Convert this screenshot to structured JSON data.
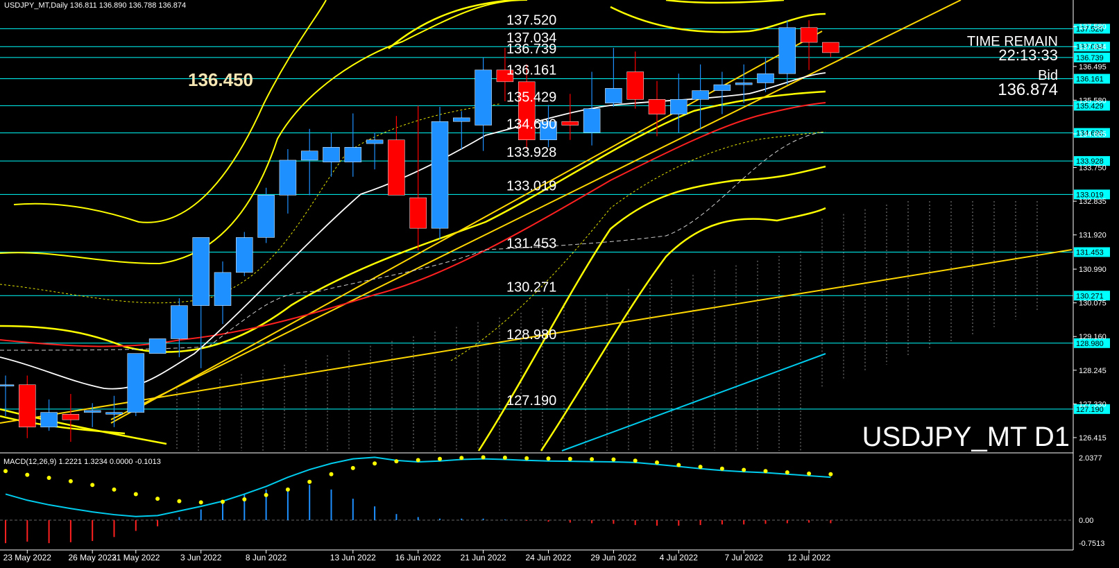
{
  "header": "USDJPY_MT,Daily  136.811 136.890 136.788 136.874",
  "symbol_label": "USDJPY_MT D1",
  "time_remain_label": "TIME REMAIN",
  "time_remain_value": "22:13:33",
  "bid_label": "Bid",
  "bid_value": "136.874",
  "marker_label": "136.450",
  "macd_label": "MACD(12,26,9) 1.2221 1.3234 0.0000 -0.1013",
  "colors": {
    "bull": "#1e90ff",
    "bear": "#ff0000",
    "level": "#00ffff",
    "trend": "#ffd700",
    "bands": "#ffff00",
    "ma_red": "#ff2020",
    "ma_white": "#ffffff",
    "macd_line": "#00ccee",
    "macd_signal": "#ffff00"
  },
  "chart_data": {
    "type": "candlestick",
    "dates": [
      "2022-05-20",
      "2022-05-23",
      "2022-05-24",
      "2022-05-25",
      "2022-05-26",
      "2022-05-27",
      "2022-05-30",
      "2022-05-31",
      "2022-06-01",
      "2022-06-02",
      "2022-06-03",
      "2022-06-06",
      "2022-06-07",
      "2022-06-08",
      "2022-06-09",
      "2022-06-10",
      "2022-06-13",
      "2022-06-14",
      "2022-06-15",
      "2022-06-16",
      "2022-06-17",
      "2022-06-20",
      "2022-06-21",
      "2022-06-22",
      "2022-06-23",
      "2022-06-24",
      "2022-06-27",
      "2022-06-28",
      "2022-06-29",
      "2022-06-30",
      "2022-07-01",
      "2022-07-04",
      "2022-07-05",
      "2022-07-06",
      "2022-07-07",
      "2022-07-08",
      "2022-07-11",
      "2022-07-12",
      "2022-07-13"
    ],
    "open": [
      127.85,
      127.85,
      126.7,
      127.05,
      127.1,
      127.05,
      127.1,
      128.7,
      129.1,
      130.0,
      130.0,
      130.9,
      131.85,
      133.0,
      133.95,
      133.9,
      133.9,
      134.4,
      134.5,
      132.93,
      132.1,
      135.0,
      134.9,
      136.4,
      136.08,
      134.5,
      135.0,
      134.7,
      135.5,
      136.35,
      135.6,
      135.2,
      135.6,
      135.84,
      136.0,
      136.05,
      136.3,
      137.55,
      137.15
    ],
    "high": [
      128.1,
      128.1,
      127.45,
      127.6,
      127.35,
      127.55,
      128.5,
      128.95,
      130.2,
      130.6,
      131.2,
      132.0,
      133.2,
      134.25,
      134.8,
      134.7,
      135.22,
      134.7,
      135.15,
      135.43,
      135.4,
      135.28,
      136.74,
      137.0,
      136.55,
      135.45,
      135.75,
      136.35,
      137.0,
      136.9,
      136.1,
      136.3,
      136.55,
      136.35,
      136.55,
      136.75,
      137.75,
      137.75,
      136.9
    ],
    "low": [
      127.0,
      126.4,
      126.6,
      126.3,
      126.7,
      126.7,
      127.0,
      128.7,
      128.6,
      128.3,
      129.5,
      130.8,
      131.7,
      132.5,
      133.0,
      133.5,
      133.5,
      133.7,
      133.5,
      131.5,
      131.8,
      134.25,
      134.2,
      135.55,
      134.25,
      134.3,
      134.5,
      134.35,
      135.4,
      135.35,
      134.6,
      134.7,
      134.8,
      135.2,
      135.5,
      135.8,
      136.0,
      136.4,
      136.75
    ],
    "close": [
      127.85,
      126.7,
      127.1,
      126.9,
      127.15,
      127.1,
      128.7,
      129.1,
      130.0,
      131.85,
      130.9,
      131.85,
      133.0,
      133.95,
      134.2,
      134.3,
      134.3,
      134.5,
      133.0,
      132.1,
      135.0,
      135.1,
      136.4,
      136.08,
      134.5,
      135.0,
      134.9,
      135.35,
      135.9,
      135.6,
      135.2,
      135.6,
      135.84,
      136.0,
      136.05,
      136.3,
      137.55,
      137.15,
      136.87
    ],
    "levels": [
      {
        "value": 137.52,
        "label": "137.520"
      },
      {
        "value": 137.034,
        "label": "137.034"
      },
      {
        "value": 136.739,
        "label": "136.739"
      },
      {
        "value": 136.161,
        "label": "136.161"
      },
      {
        "value": 135.429,
        "label": "135.429"
      },
      {
        "value": 134.69,
        "label": "134.690"
      },
      {
        "value": 133.928,
        "label": "133.928"
      },
      {
        "value": 133.019,
        "label": "133.019"
      },
      {
        "value": 131.453,
        "label": "131.453"
      },
      {
        "value": 130.271,
        "label": "130.271"
      },
      {
        "value": 128.98,
        "label": "128.980"
      },
      {
        "value": 127.19,
        "label": "127.190"
      }
    ],
    "y_ticks": [
      "137.580",
      "137.034",
      "136.495",
      "135.580",
      "134.665",
      "133.750",
      "132.835",
      "131.920",
      "130.990",
      "130.075",
      "129.160",
      "128.245",
      "127.330",
      "126.415"
    ],
    "y_tick_values": [
      137.58,
      137.034,
      136.495,
      135.58,
      134.665,
      133.75,
      132.835,
      131.92,
      130.99,
      130.075,
      129.16,
      128.245,
      127.33,
      126.415
    ],
    "x_labels": [
      {
        "index": 1,
        "label": "23 May 2022"
      },
      {
        "index": 4,
        "label": "26 May 2022"
      },
      {
        "index": 6,
        "label": "31 May 2022"
      },
      {
        "index": 9,
        "label": "3 Jun 2022"
      },
      {
        "index": 12,
        "label": "8 Jun 2022"
      },
      {
        "index": 16,
        "label": "13 Jun 2022"
      },
      {
        "index": 19,
        "label": "16 Jun 2022"
      },
      {
        "index": 22,
        "label": "21 Jun 2022"
      },
      {
        "index": 25,
        "label": "24 Jun 2022"
      },
      {
        "index": 28,
        "label": "29 Jun 2022"
      },
      {
        "index": 31,
        "label": "4 Jul 2022"
      },
      {
        "index": 34,
        "label": "7 Jul 2022"
      },
      {
        "index": 37,
        "label": "12 Jul 2022"
      }
    ],
    "ylim": [
      126.0,
      138.3
    ],
    "macd": {
      "y_ticks": [
        "2.0377",
        "0.00",
        "-0.7513"
      ],
      "y_tick_values": [
        2.0377,
        0.0,
        -0.7513
      ],
      "ylim": [
        -0.95,
        2.15
      ],
      "histogram": [
        -0.75,
        -0.7,
        -0.75,
        -0.72,
        -0.68,
        -0.55,
        -0.35,
        -0.2,
        0.1,
        0.35,
        0.55,
        0.85,
        1.0,
        1.05,
        1.15,
        1.0,
        0.7,
        0.45,
        0.2,
        0.1,
        0.05,
        0.05,
        0.05,
        0.02,
        -0.02,
        -0.05,
        -0.08,
        -0.1,
        -0.12,
        -0.16,
        -0.18,
        -0.18,
        -0.16,
        -0.14,
        -0.14,
        -0.12,
        -0.1,
        -0.08,
        -0.1
      ],
      "macd_line": [
        0.85,
        0.65,
        0.5,
        0.38,
        0.27,
        0.18,
        0.12,
        0.15,
        0.3,
        0.45,
        0.62,
        0.85,
        1.1,
        1.4,
        1.65,
        1.85,
        2.0,
        2.05,
        1.95,
        1.9,
        1.93,
        1.98,
        2.0,
        1.98,
        1.95,
        1.93,
        1.92,
        1.91,
        1.9,
        1.88,
        1.82,
        1.75,
        1.68,
        1.62,
        1.58,
        1.55,
        1.5,
        1.45,
        1.4
      ],
      "signal_line": [
        1.6,
        1.48,
        1.38,
        1.27,
        1.15,
        1.0,
        0.85,
        0.7,
        0.62,
        0.58,
        0.6,
        0.68,
        0.82,
        1.0,
        1.25,
        1.5,
        1.7,
        1.85,
        1.92,
        1.96,
        2.0,
        2.03,
        2.05,
        2.04,
        2.02,
        2.01,
        2.0,
        1.99,
        1.98,
        1.94,
        1.88,
        1.8,
        1.74,
        1.68,
        1.64,
        1.6,
        1.56,
        1.52,
        1.5
      ]
    }
  }
}
